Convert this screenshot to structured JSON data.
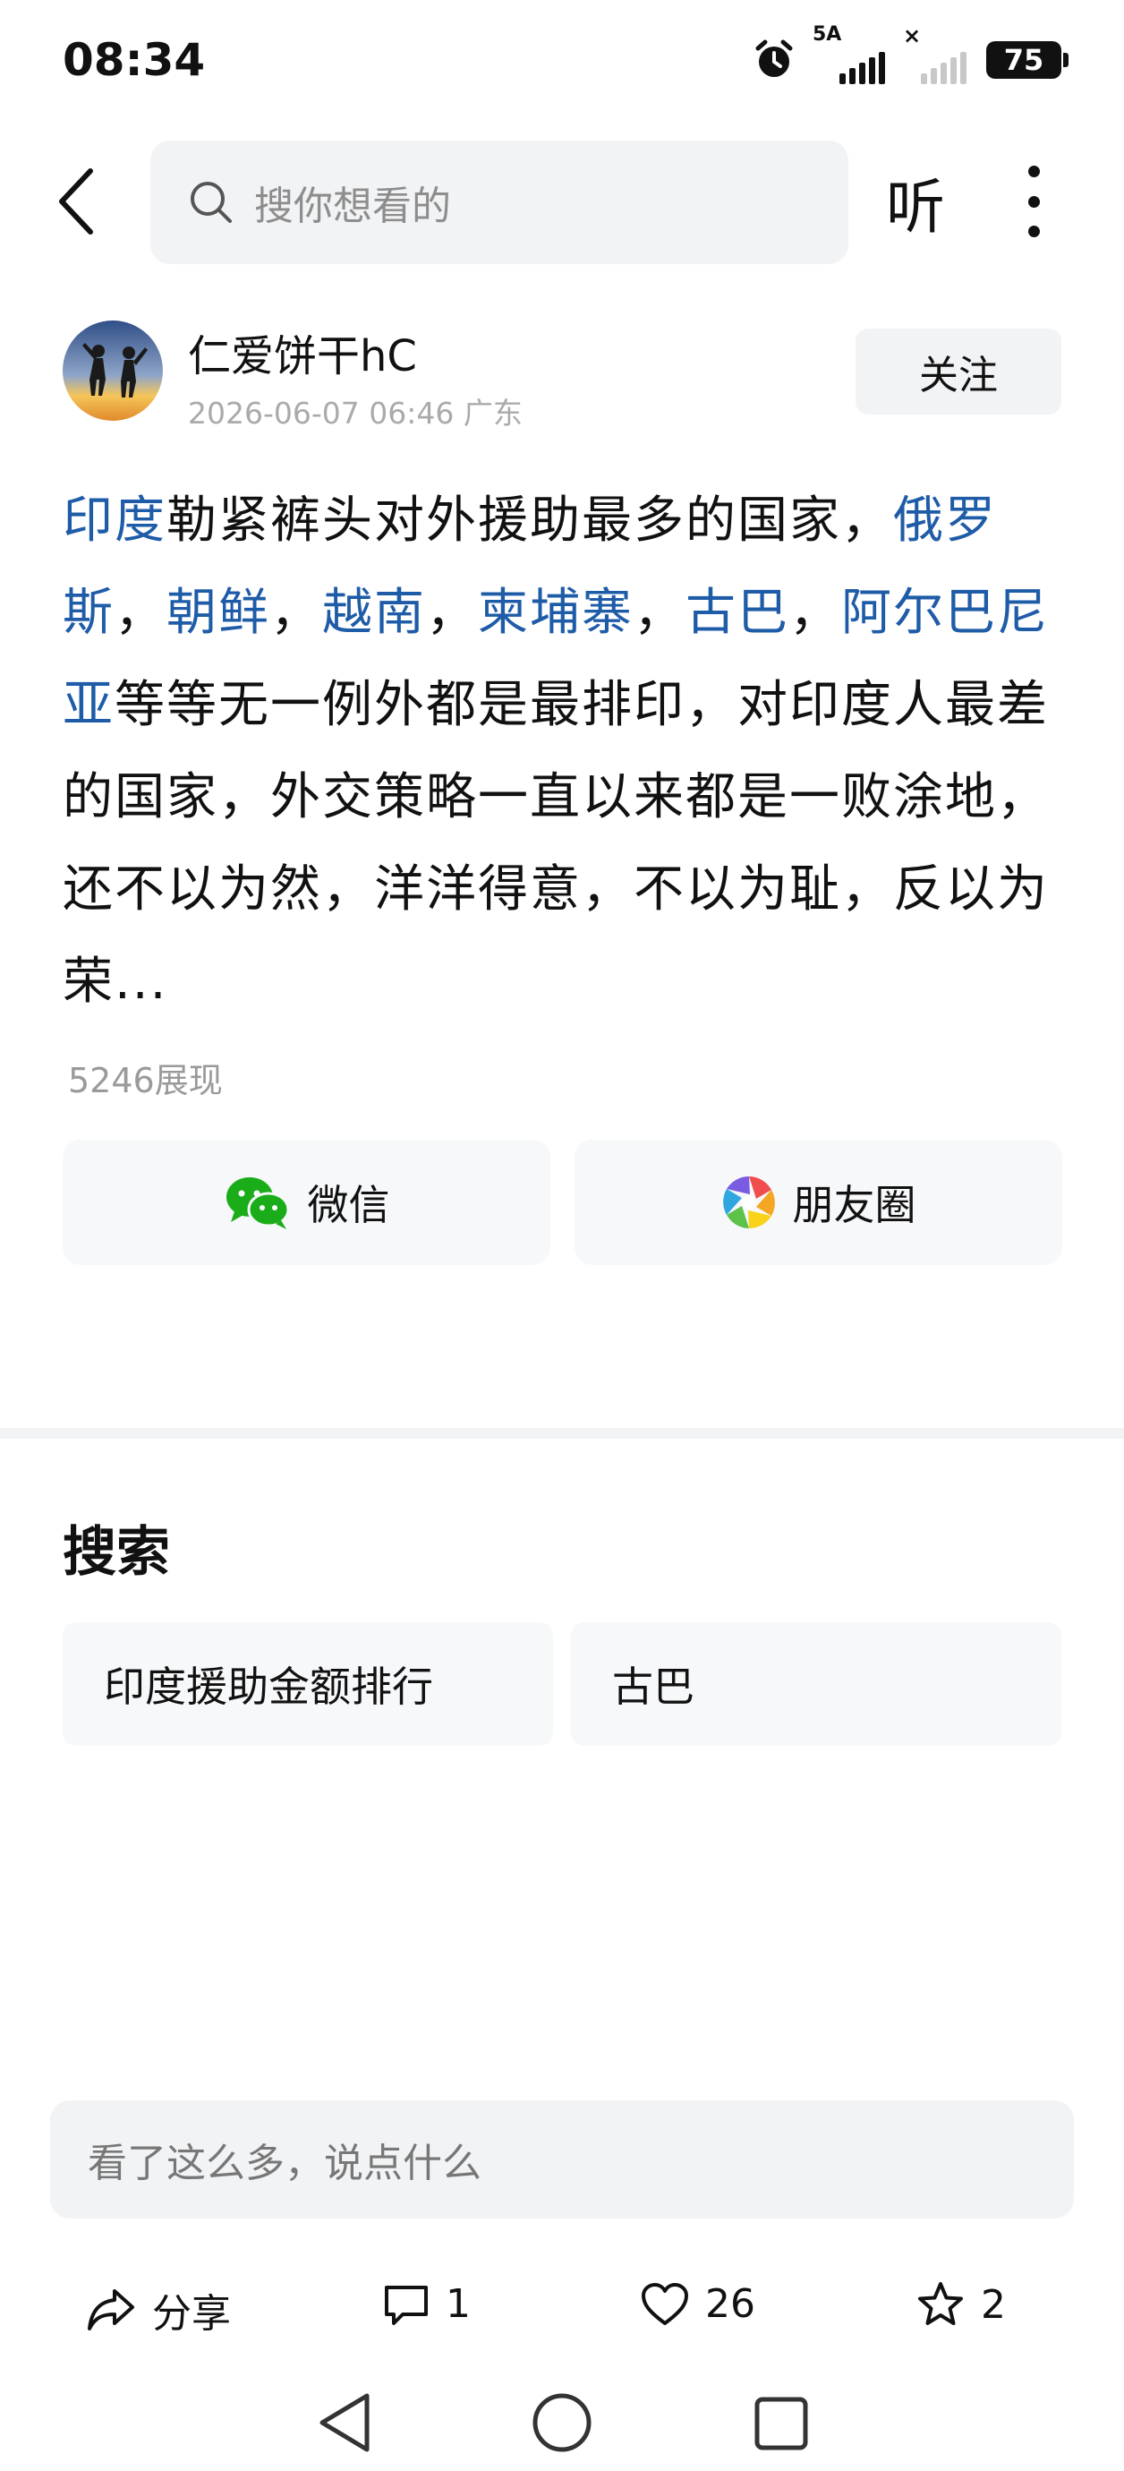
{
  "status_bar": {
    "time": "08:34",
    "network_label": "5A",
    "battery": "75"
  },
  "top_nav": {
    "search_placeholder": "搜你想看的",
    "listen_label": "听"
  },
  "author": {
    "name": "仁爱饼干hC",
    "meta": "2026-06-07 06:46 广东",
    "follow_label": "关注"
  },
  "post": {
    "seg1": "印度",
    "seg2": "勒紧裤头对外援助最多的国家，",
    "seg3": "俄罗斯",
    "seg4": "，",
    "seg5": "朝鲜",
    "seg6": "，",
    "seg7": "越南",
    "seg8": "，",
    "seg9": "柬埔寨",
    "seg10": "，",
    "seg11": "古巴",
    "seg12": "，",
    "seg13": "阿尔巴尼亚",
    "seg14": "等等无一例外都是最排印，对印度人最差的国家，外交策略一直以来都是一败涂地，还不以为然，洋洋得意，不以为耻，反以为荣...",
    "views": "5246展现"
  },
  "share": {
    "wechat_label": "微信",
    "moments_label": "朋友圈"
  },
  "related_search": {
    "heading": "搜索",
    "chips": [
      "印度援助金额排行",
      "古巴"
    ]
  },
  "comment": {
    "placeholder": "看了这么多，说点什么"
  },
  "actions": {
    "share_label": "分享",
    "comment_count": "1",
    "like_count": "26",
    "favorite_count": "2"
  },
  "colors": {
    "link": "#1f5ca8",
    "wechat_green": "#1aad19",
    "panel_bg": "#f2f3f5"
  }
}
